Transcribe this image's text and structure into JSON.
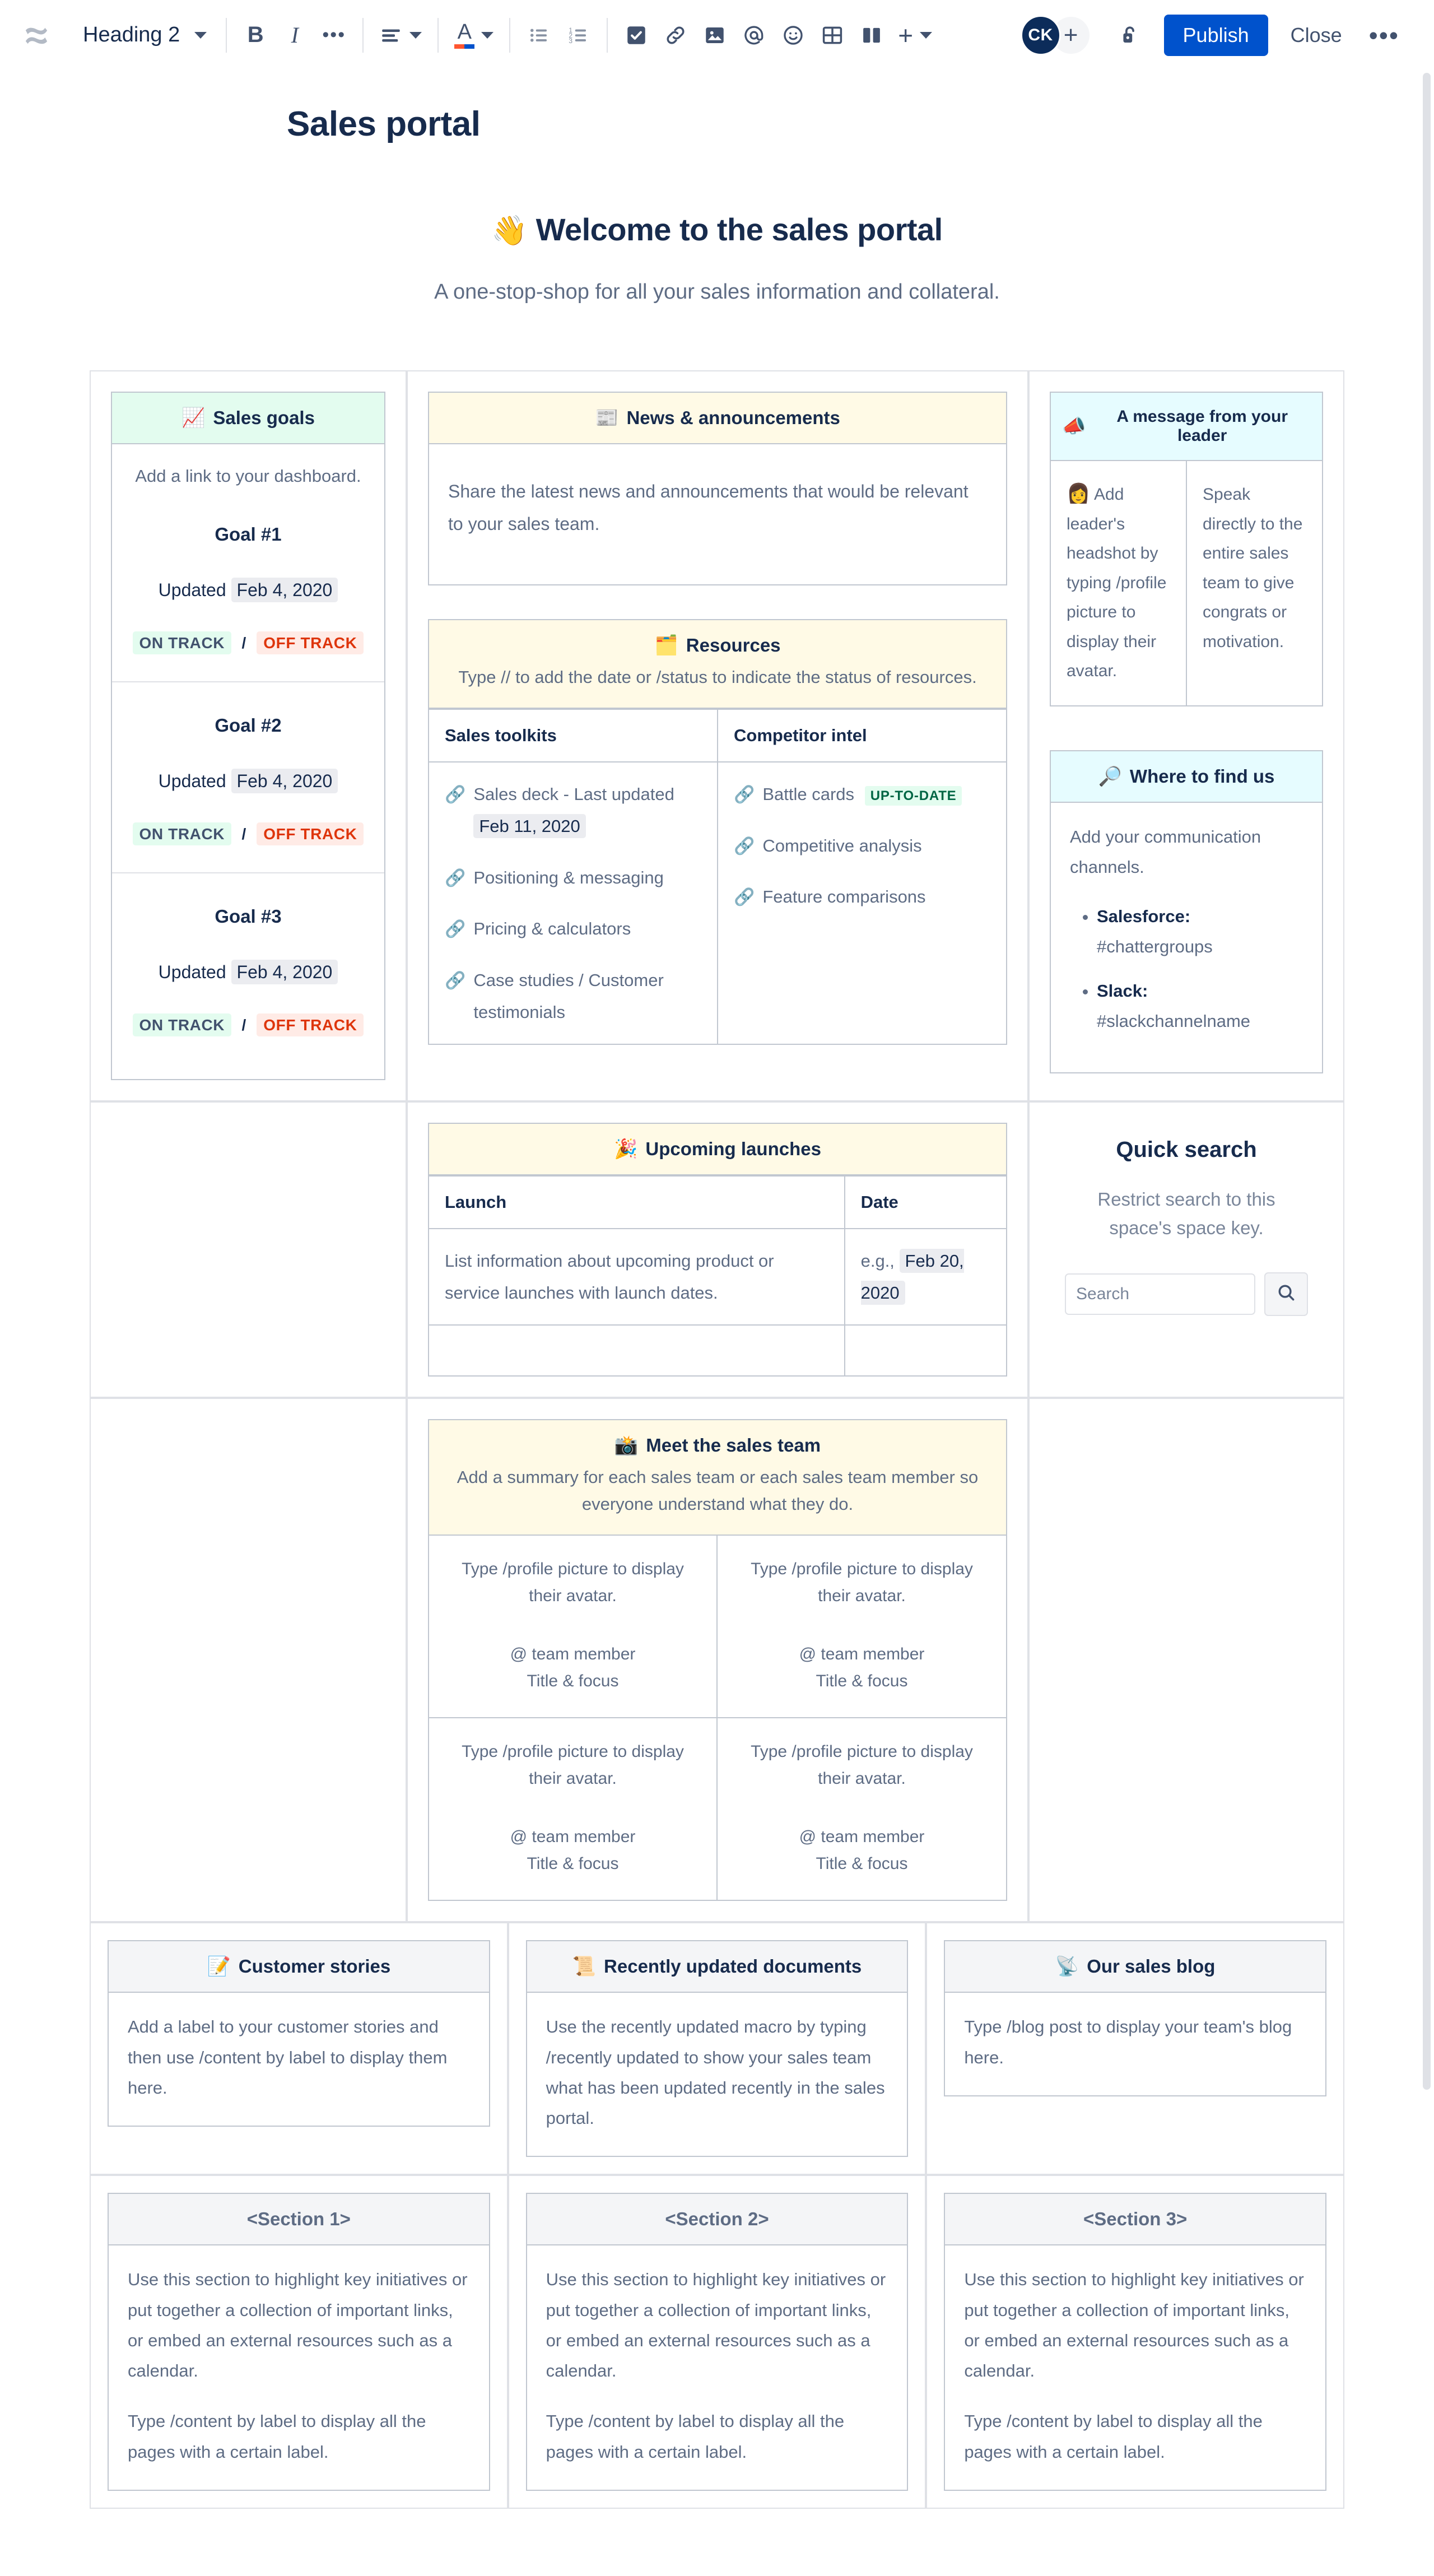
{
  "toolbar": {
    "logo_icon": "confluence-logo-icon",
    "heading_label": "Heading 2",
    "bold_label": "B",
    "italic_label": "I",
    "more_formatting_label": "•••",
    "align_icon": "text-align-icon",
    "text_color_label": "A",
    "bullet_list_icon": "bullet-list-icon",
    "numbered_list_icon": "numbered-list-icon",
    "task_icon": "task-checkbox-icon",
    "link_icon": "link-icon",
    "image_icon": "image-icon",
    "mention_icon": "mention-at-icon",
    "emoji_icon": "emoji-icon",
    "table_icon": "table-icon",
    "layout_icon": "layout-columns-icon",
    "insert_label": "+",
    "avatar_initials": "CK",
    "add_person_label": "+",
    "lock_icon": "unlock-icon",
    "publish_label": "Publish",
    "close_label": "Close",
    "overflow_label": "•••"
  },
  "page": {
    "title": "Sales portal",
    "hero_emoji": "👋",
    "hero_title": "Welcome to the sales portal",
    "hero_subtitle": "A one-stop-shop for all your sales information and collateral."
  },
  "sales_goals": {
    "emoji": "📈",
    "title": "Sales goals",
    "note": "Add a link to your dashboard.",
    "updated_label": "Updated",
    "on_track_label": "ON TRACK",
    "off_track_label": "OFF TRACK",
    "separator": "/",
    "goals": [
      {
        "name": "Goal #1",
        "date": "Feb 4, 2020"
      },
      {
        "name": "Goal #2",
        "date": "Feb 4, 2020"
      },
      {
        "name": "Goal #3",
        "date": "Feb 4, 2020"
      }
    ]
  },
  "news": {
    "emoji": "📰",
    "title": "News & announcements",
    "body": "Share the latest news and announcements that would be relevant to your sales team."
  },
  "resources": {
    "emoji": "🗂️",
    "title": "Resources",
    "subtitle": "Type // to add the date or /status to indicate the status of resources.",
    "col1_header": "Sales toolkits",
    "col2_header": "Competitor intel",
    "toolkits": [
      {
        "label": "Sales deck - Last updated",
        "date": "Feb 11, 2020"
      },
      {
        "label": "Positioning & messaging",
        "date": ""
      },
      {
        "label": "Pricing & calculators",
        "date": ""
      },
      {
        "label": "Case studies / Customer testimonials",
        "date": ""
      }
    ],
    "competitor": [
      {
        "label": "Battle cards",
        "status": "UP-TO-DATE"
      },
      {
        "label": "Competitive analysis",
        "status": ""
      },
      {
        "label": "Feature comparisons",
        "status": ""
      }
    ]
  },
  "leader": {
    "emoji": "📣",
    "title": "A message from your leader",
    "left_emoji": "👩",
    "left_text": "Add leader's headshot by typing /profile picture to display their avatar.",
    "right_text": "Speak directly to the entire sales team to give congrats or motivation."
  },
  "find_us": {
    "emoji": "🔎",
    "title": "Where to find us",
    "note": "Add your communication channels.",
    "channels": [
      {
        "name": "Salesforce:",
        "value": "#chattergroups"
      },
      {
        "name": "Slack:",
        "value": "#slackchannelname"
      }
    ]
  },
  "launches": {
    "emoji": "🎉",
    "title": "Upcoming launches",
    "col1_header": "Launch",
    "col2_header": "Date",
    "row1_launch": "List information about upcoming product or service launches with launch dates.",
    "row1_date_prefix": "e.g.,",
    "row1_date": "Feb 20, 2020",
    "row2_launch": "",
    "row2_date": ""
  },
  "quick_search": {
    "title": "Quick search",
    "description": "Restrict search to this space's space key.",
    "placeholder": "Search",
    "value": "",
    "search_icon": "search-icon"
  },
  "team": {
    "emoji": "📸",
    "title": "Meet the sales team",
    "subtitle": "Add a summary for each sales team or each sales team member so everyone understand what they do.",
    "members": [
      {
        "avatar_hint": "Type /profile picture to display their avatar.",
        "handle": "@ team member",
        "title": "Title & focus"
      },
      {
        "avatar_hint": "Type /profile picture to display their avatar.",
        "handle": "@ team member",
        "title": "Title & focus"
      },
      {
        "avatar_hint": "Type /profile picture to display their avatar.",
        "handle": "@ team member",
        "title": "Title & focus"
      },
      {
        "avatar_hint": "Type /profile picture to display their avatar.",
        "handle": "@ team member",
        "title": "Title & focus"
      }
    ]
  },
  "customer_stories": {
    "emoji": "📝",
    "title": "Customer stories",
    "body": "Add a label to your customer stories and then use /content by label to display them here."
  },
  "recent_docs": {
    "emoji": "📜",
    "title": "Recently updated documents",
    "body": "Use the recently updated macro by typing /recently updated to show your sales team what has been updated recently in the sales portal."
  },
  "sales_blog": {
    "emoji": "📡",
    "title": "Our sales blog",
    "body": "Type /blog post to display your team's blog here."
  },
  "sections": [
    {
      "title": "<Section 1>",
      "body1": "Use this section to highlight key initiatives or put together a collection of important links, or embed an external resources such as a calendar.",
      "body2": "Type /content by label to display all the pages with a certain label."
    },
    {
      "title": "<Section 2>",
      "body1": "Use this section to highlight key initiatives or put together a collection of important links, or embed an external resources such as a calendar.",
      "body2": "Type /content by label to display all the pages with a certain label."
    },
    {
      "title": "<Section 3>",
      "body1": "Use this section to highlight key initiatives or put together a collection of important links, or embed an external resources such as a calendar.",
      "body2": "Type /content by label to display all the pages with a certain label."
    }
  ],
  "colors": {
    "brand_blue": "#0052cc",
    "text": "#172b4d",
    "subtle_text": "#5e6c84",
    "green_bg": "#e3fcef",
    "yellow_bg": "#fffae6",
    "blue_bg": "#e6fcff",
    "grey_bg": "#f4f5f7",
    "red_text": "#de350b"
  }
}
